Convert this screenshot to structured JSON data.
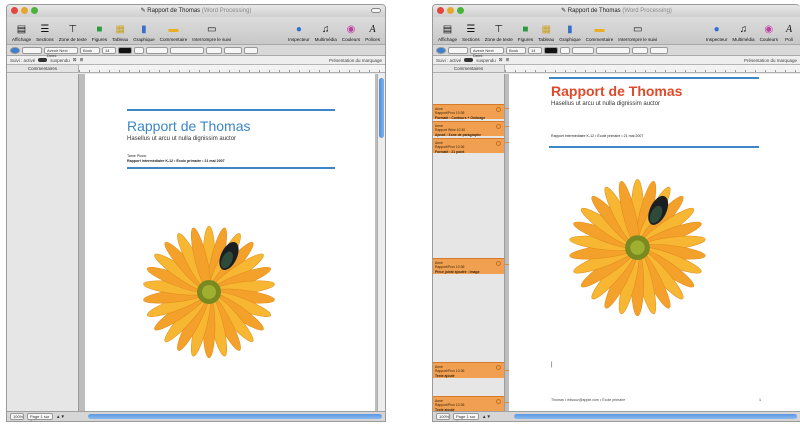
{
  "window_title_left": "Rapport de Thomas",
  "window_title_left_suffix": "(Word Processing)",
  "window_title_right": "Rapport de Thomas",
  "window_title_right_suffix": "(Word Processing)",
  "toolbar_left": [
    "Affichage",
    "Sections",
    "Zone de texte",
    "Figures",
    "Tableau",
    "Graphique",
    "Commentaire",
    "Interrompre le suivi",
    "Inspecteur",
    "Multimédia",
    "Couleurs",
    "Polices"
  ],
  "toolbar_right": [
    "Affichage",
    "Sections",
    "Zone de texte",
    "Figures",
    "Tableau",
    "Graphique",
    "Commentaire",
    "Interrompre le suivi",
    "Inspecteur",
    "Multimédia",
    "Couleurs",
    "Poli"
  ],
  "format_font": "Avenir Next Demi",
  "format_style": "Book",
  "format_size": "14",
  "tracking_left": "Suivi : activé",
  "tracking_left_state": "suspendu",
  "tracking_left_right": "Présentation du marquage",
  "tracking_right": "Suivi : activé",
  "tracking_right_state": "suspendu",
  "tracking_right_right": "Présentation du marquage",
  "comments_header_left": "Commentaires",
  "comments_header_right": "Commentaires",
  "doc_title": "Rapport de Thomas",
  "doc_subtitle": "Hasellus ut arcu ut nulla dignissim auctor",
  "doc_author": "Tame Piccio",
  "doc_info": "Rapport intermédiaire K-12 • École primaire • 21 mai 2007",
  "doc_footer": "Thomas • edsouz@apple.com • École primaire",
  "doc_page_number": "1",
  "comments": [
    {
      "author": "Anne",
      "meta": "Rapport/Prov 10:38",
      "text": "Formaté : Contours + Ombrage"
    },
    {
      "author": "Anne",
      "meta": "Rapport Wine 10:30",
      "text": "Ajouté : Zone de paragraphe"
    },
    {
      "author": "Anne",
      "meta": "Rapport/Prov 10:36",
      "text": "Formaté : 21 point"
    },
    {
      "author": "Anne",
      "meta": "Rapport/Prov 10:36",
      "text": "Pièce jointe ajoutée : Image"
    },
    {
      "author": "Anne",
      "meta": "Rapport/Prov 10:36",
      "text": "Texte ajouté"
    },
    {
      "author": "Anne",
      "meta": "Rapport/Prov 10:36",
      "text": "Texte ajouté"
    }
  ],
  "status_left_zoom": "100%",
  "status_left_page": "Page 1 sur 2",
  "status_right_zoom": "100%",
  "status_right_page": "Page 1 sur 6",
  "colors": {
    "accent": "#3b87c5",
    "comment": "#f0a050",
    "title_right": "#e04a2a"
  }
}
